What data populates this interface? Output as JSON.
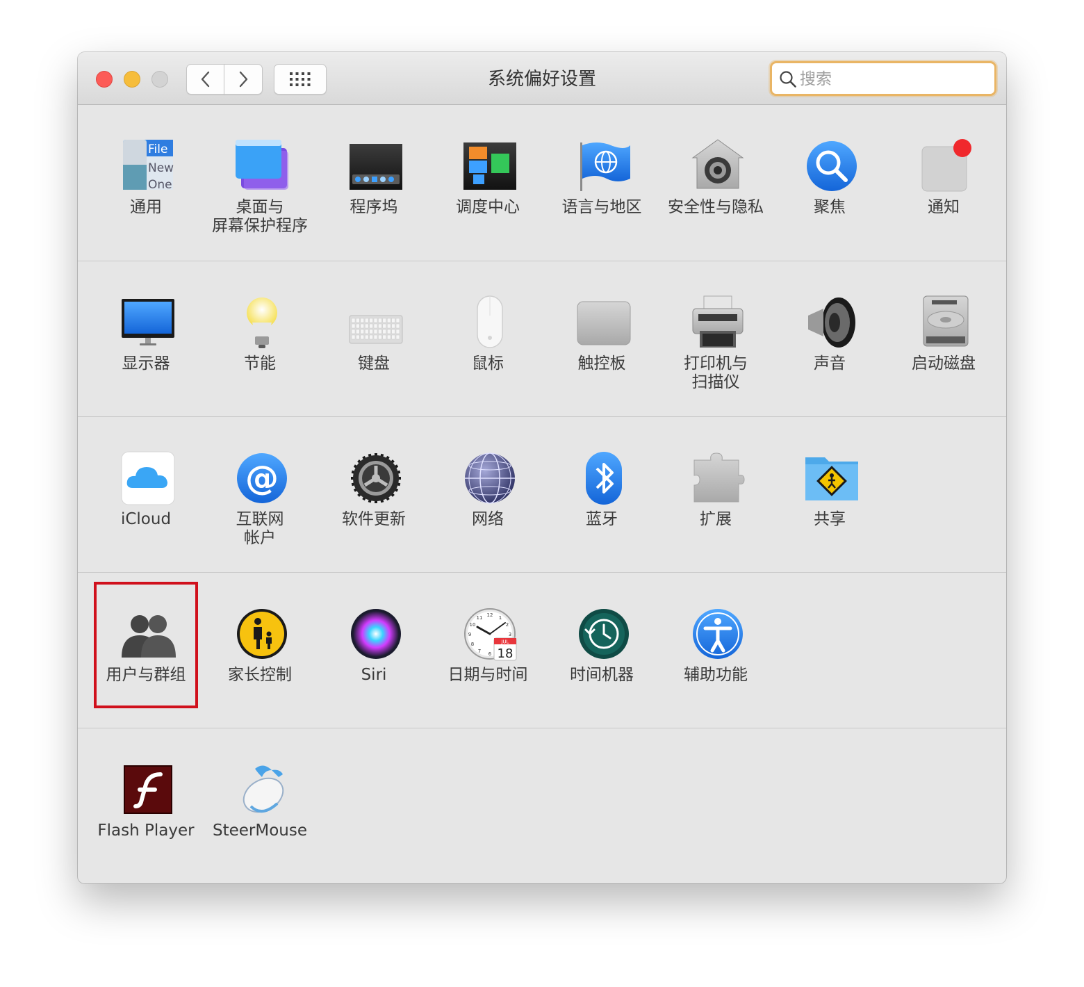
{
  "window": {
    "title": "系统偏好设置",
    "search_placeholder": "搜索"
  },
  "rows": [
    {
      "items": [
        {
          "id": "general",
          "label": "通用",
          "icon": "general-icon"
        },
        {
          "id": "desktop-screensaver",
          "label": "桌面与\n屏幕保护程序",
          "icon": "desktop-screensaver-icon"
        },
        {
          "id": "dock",
          "label": "程序坞",
          "icon": "dock-icon"
        },
        {
          "id": "mission-control",
          "label": "调度中心",
          "icon": "mission-control-icon"
        },
        {
          "id": "language-region",
          "label": "语言与地区",
          "icon": "language-region-icon"
        },
        {
          "id": "security-privacy",
          "label": "安全性与隐私",
          "icon": "security-privacy-icon"
        },
        {
          "id": "spotlight",
          "label": "聚焦",
          "icon": "spotlight-icon"
        },
        {
          "id": "notifications",
          "label": "通知",
          "icon": "notifications-icon"
        }
      ]
    },
    {
      "items": [
        {
          "id": "displays",
          "label": "显示器",
          "icon": "displays-icon"
        },
        {
          "id": "energy-saver",
          "label": "节能",
          "icon": "energy-saver-icon"
        },
        {
          "id": "keyboard",
          "label": "键盘",
          "icon": "keyboard-icon"
        },
        {
          "id": "mouse",
          "label": "鼠标",
          "icon": "mouse-icon"
        },
        {
          "id": "trackpad",
          "label": "触控板",
          "icon": "trackpad-icon"
        },
        {
          "id": "printers-scanners",
          "label": "打印机与\n扫描仪",
          "icon": "printers-scanners-icon"
        },
        {
          "id": "sound",
          "label": "声音",
          "icon": "sound-icon"
        },
        {
          "id": "startup-disk",
          "label": "启动磁盘",
          "icon": "startup-disk-icon"
        }
      ]
    },
    {
      "items": [
        {
          "id": "icloud",
          "label": "iCloud",
          "icon": "icloud-icon"
        },
        {
          "id": "internet-accounts",
          "label": "互联网\n帐户",
          "icon": "internet-accounts-icon"
        },
        {
          "id": "software-update",
          "label": "软件更新",
          "icon": "software-update-icon"
        },
        {
          "id": "network",
          "label": "网络",
          "icon": "network-icon"
        },
        {
          "id": "bluetooth",
          "label": "蓝牙",
          "icon": "bluetooth-icon"
        },
        {
          "id": "extensions",
          "label": "扩展",
          "icon": "extensions-icon"
        },
        {
          "id": "sharing",
          "label": "共享",
          "icon": "sharing-icon"
        }
      ]
    },
    {
      "items": [
        {
          "id": "users-groups",
          "label": "用户与群组",
          "icon": "users-groups-icon",
          "highlighted": true
        },
        {
          "id": "parental-controls",
          "label": "家长控制",
          "icon": "parental-controls-icon"
        },
        {
          "id": "siri",
          "label": "Siri",
          "icon": "siri-icon"
        },
        {
          "id": "date-time",
          "label": "日期与时间",
          "icon": "date-time-icon"
        },
        {
          "id": "time-machine",
          "label": "时间机器",
          "icon": "time-machine-icon"
        },
        {
          "id": "accessibility",
          "label": "辅助功能",
          "icon": "accessibility-icon"
        }
      ]
    },
    {
      "items": [
        {
          "id": "flash-player",
          "label": "Flash Player",
          "icon": "flash-player-icon"
        },
        {
          "id": "steermouse",
          "label": "SteerMouse",
          "icon": "steermouse-icon"
        }
      ]
    }
  ],
  "icon_text": {
    "general": [
      "File",
      "New",
      "One"
    ],
    "date_month": "JUL",
    "date_day": "18",
    "clock_numbers": [
      "12",
      "11",
      "1",
      "10",
      "2",
      "9",
      "3",
      "8",
      "4",
      "7",
      "5",
      "6"
    ]
  },
  "colors": {
    "highlight_border": "#d0101c",
    "search_focus": "#e9b565",
    "close": "#fc5b57",
    "minimize": "#f6bd3b",
    "zoom": "#d3d3d3"
  }
}
